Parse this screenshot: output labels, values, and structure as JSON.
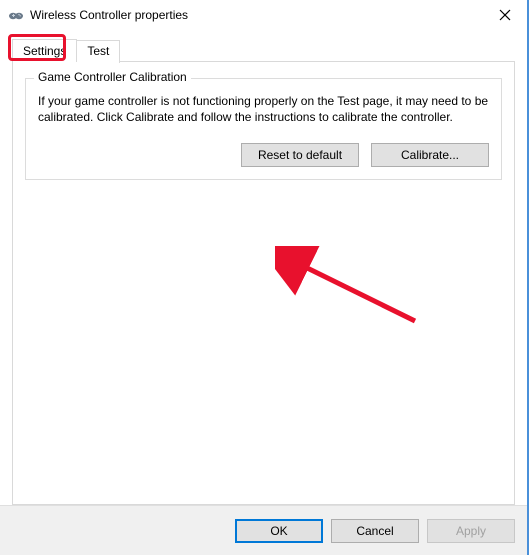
{
  "window": {
    "title": "Wireless Controller properties"
  },
  "tabs": {
    "settings": "Settings",
    "test": "Test"
  },
  "group": {
    "title": "Game Controller Calibration",
    "description": "If your game controller is not functioning properly on the Test page, it may need to be calibrated.  Click Calibrate and follow the instructions to calibrate the controller.",
    "reset_label": "Reset to default",
    "calibrate_label": "Calibrate..."
  },
  "footer": {
    "ok": "OK",
    "cancel": "Cancel",
    "apply": "Apply"
  }
}
